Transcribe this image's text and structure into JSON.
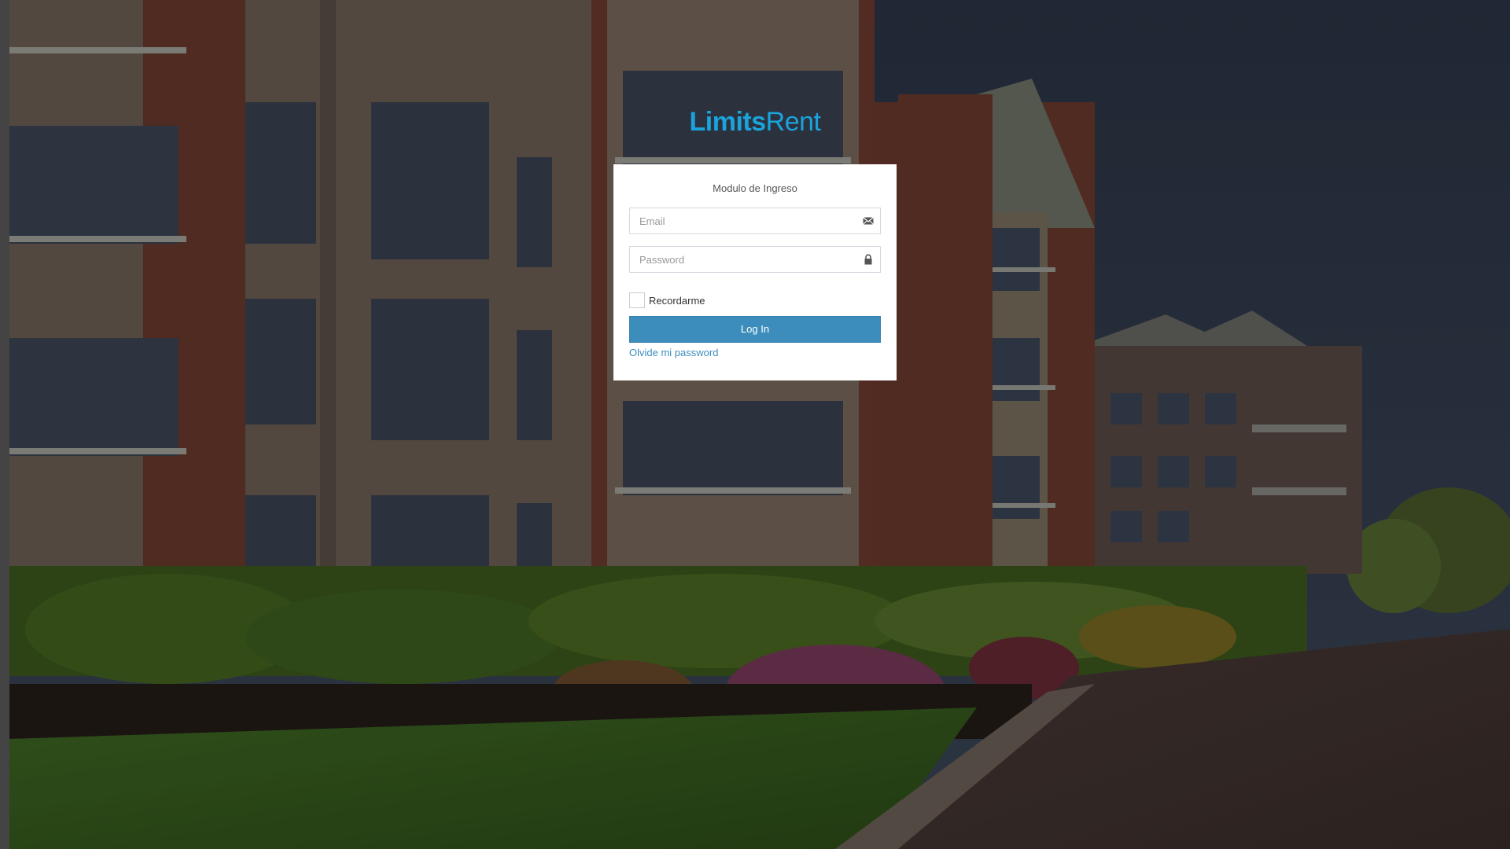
{
  "brand": {
    "name_strong": "Limits",
    "name_light": "Rent",
    "color": "#1aa3dc"
  },
  "login_box": {
    "title": "Modulo de Ingreso",
    "email": {
      "placeholder": "Email",
      "value": "",
      "icon": "envelope-icon"
    },
    "password": {
      "placeholder": "Password",
      "value": "",
      "icon": "lock-icon"
    },
    "remember_label": "Recordarme",
    "remember_checked": false,
    "login_label": "Log In",
    "forgot_label": "Olvide mi password"
  },
  "colors": {
    "primary_button": "#3c8dbc",
    "link": "#3c8dbc"
  },
  "background": {
    "description_icon": "apartment-building-photo"
  }
}
